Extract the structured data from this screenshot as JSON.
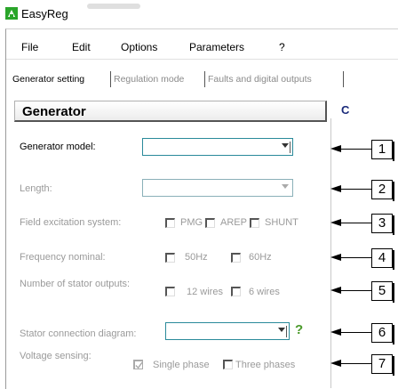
{
  "window": {
    "title": "EasyReg"
  },
  "menu": [
    "File",
    "Edit",
    "Options",
    "Parameters",
    "?"
  ],
  "tabs": [
    {
      "label": "Generator setting",
      "active": true
    },
    {
      "label": "Regulation mode",
      "active": false
    },
    {
      "label": "Faults and digital outputs",
      "active": false
    }
  ],
  "group": {
    "title": "Generator",
    "next_group_partial": "C"
  },
  "fields": {
    "generator_model": {
      "label": "Generator model:",
      "value": ""
    },
    "length": {
      "label": "Length:",
      "value": ""
    },
    "field_excitation": {
      "label": "Field excitation system:",
      "options": [
        {
          "label": "PMG",
          "checked": false
        },
        {
          "label": "AREP",
          "checked": false
        },
        {
          "label": "SHUNT",
          "checked": false
        }
      ]
    },
    "frequency": {
      "label": "Frequency nominal:",
      "options": [
        {
          "label": "50Hz",
          "checked": false
        },
        {
          "label": "60Hz",
          "checked": false
        }
      ]
    },
    "stator_outputs": {
      "label": "Number of stator outputs:",
      "options": [
        {
          "label": "12 wires",
          "checked": false
        },
        {
          "label": "6 wires",
          "checked": false
        }
      ]
    },
    "stator_diagram": {
      "label": "Stator connection diagram:",
      "value": "",
      "help": "?"
    },
    "voltage_sensing": {
      "label": "Voltage sensing:",
      "options": [
        {
          "label": "Single phase",
          "checked": true
        },
        {
          "label": "Three phases",
          "checked": false
        }
      ]
    }
  },
  "callouts": [
    "1",
    "2",
    "3",
    "4",
    "5",
    "6",
    "7"
  ],
  "colors": {
    "accent_border": "#2a8a9a",
    "help_icon": "#4a9a2a",
    "disabled_text": "#9a9a9a"
  }
}
